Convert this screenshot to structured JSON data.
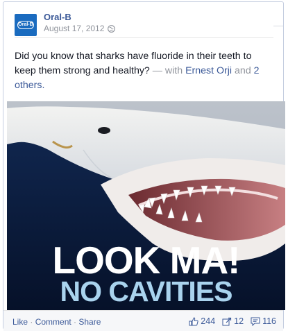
{
  "post": {
    "page_name": "Oral-B",
    "logo_text": "Oral-B",
    "date": "August 17, 2012",
    "text_main": "Did you know that sharks have fluoride in their teeth to keep them strong and healthy?",
    "text_with": " — with ",
    "tagged_person": "Ernest Orji",
    "text_and": " and ",
    "tagged_others": "2 others",
    "text_end": "."
  },
  "image": {
    "caption_line1": "LOOK MA!",
    "caption_line2": "NO CAVITIES"
  },
  "footer": {
    "like": "Like",
    "comment": "Comment",
    "share": "Share",
    "sep": " · ",
    "like_count": "244",
    "share_count": "12",
    "comment_count": "116"
  },
  "icons": [
    "globe-icon",
    "thumbs-up-icon",
    "share-icon",
    "comment-icon"
  ]
}
